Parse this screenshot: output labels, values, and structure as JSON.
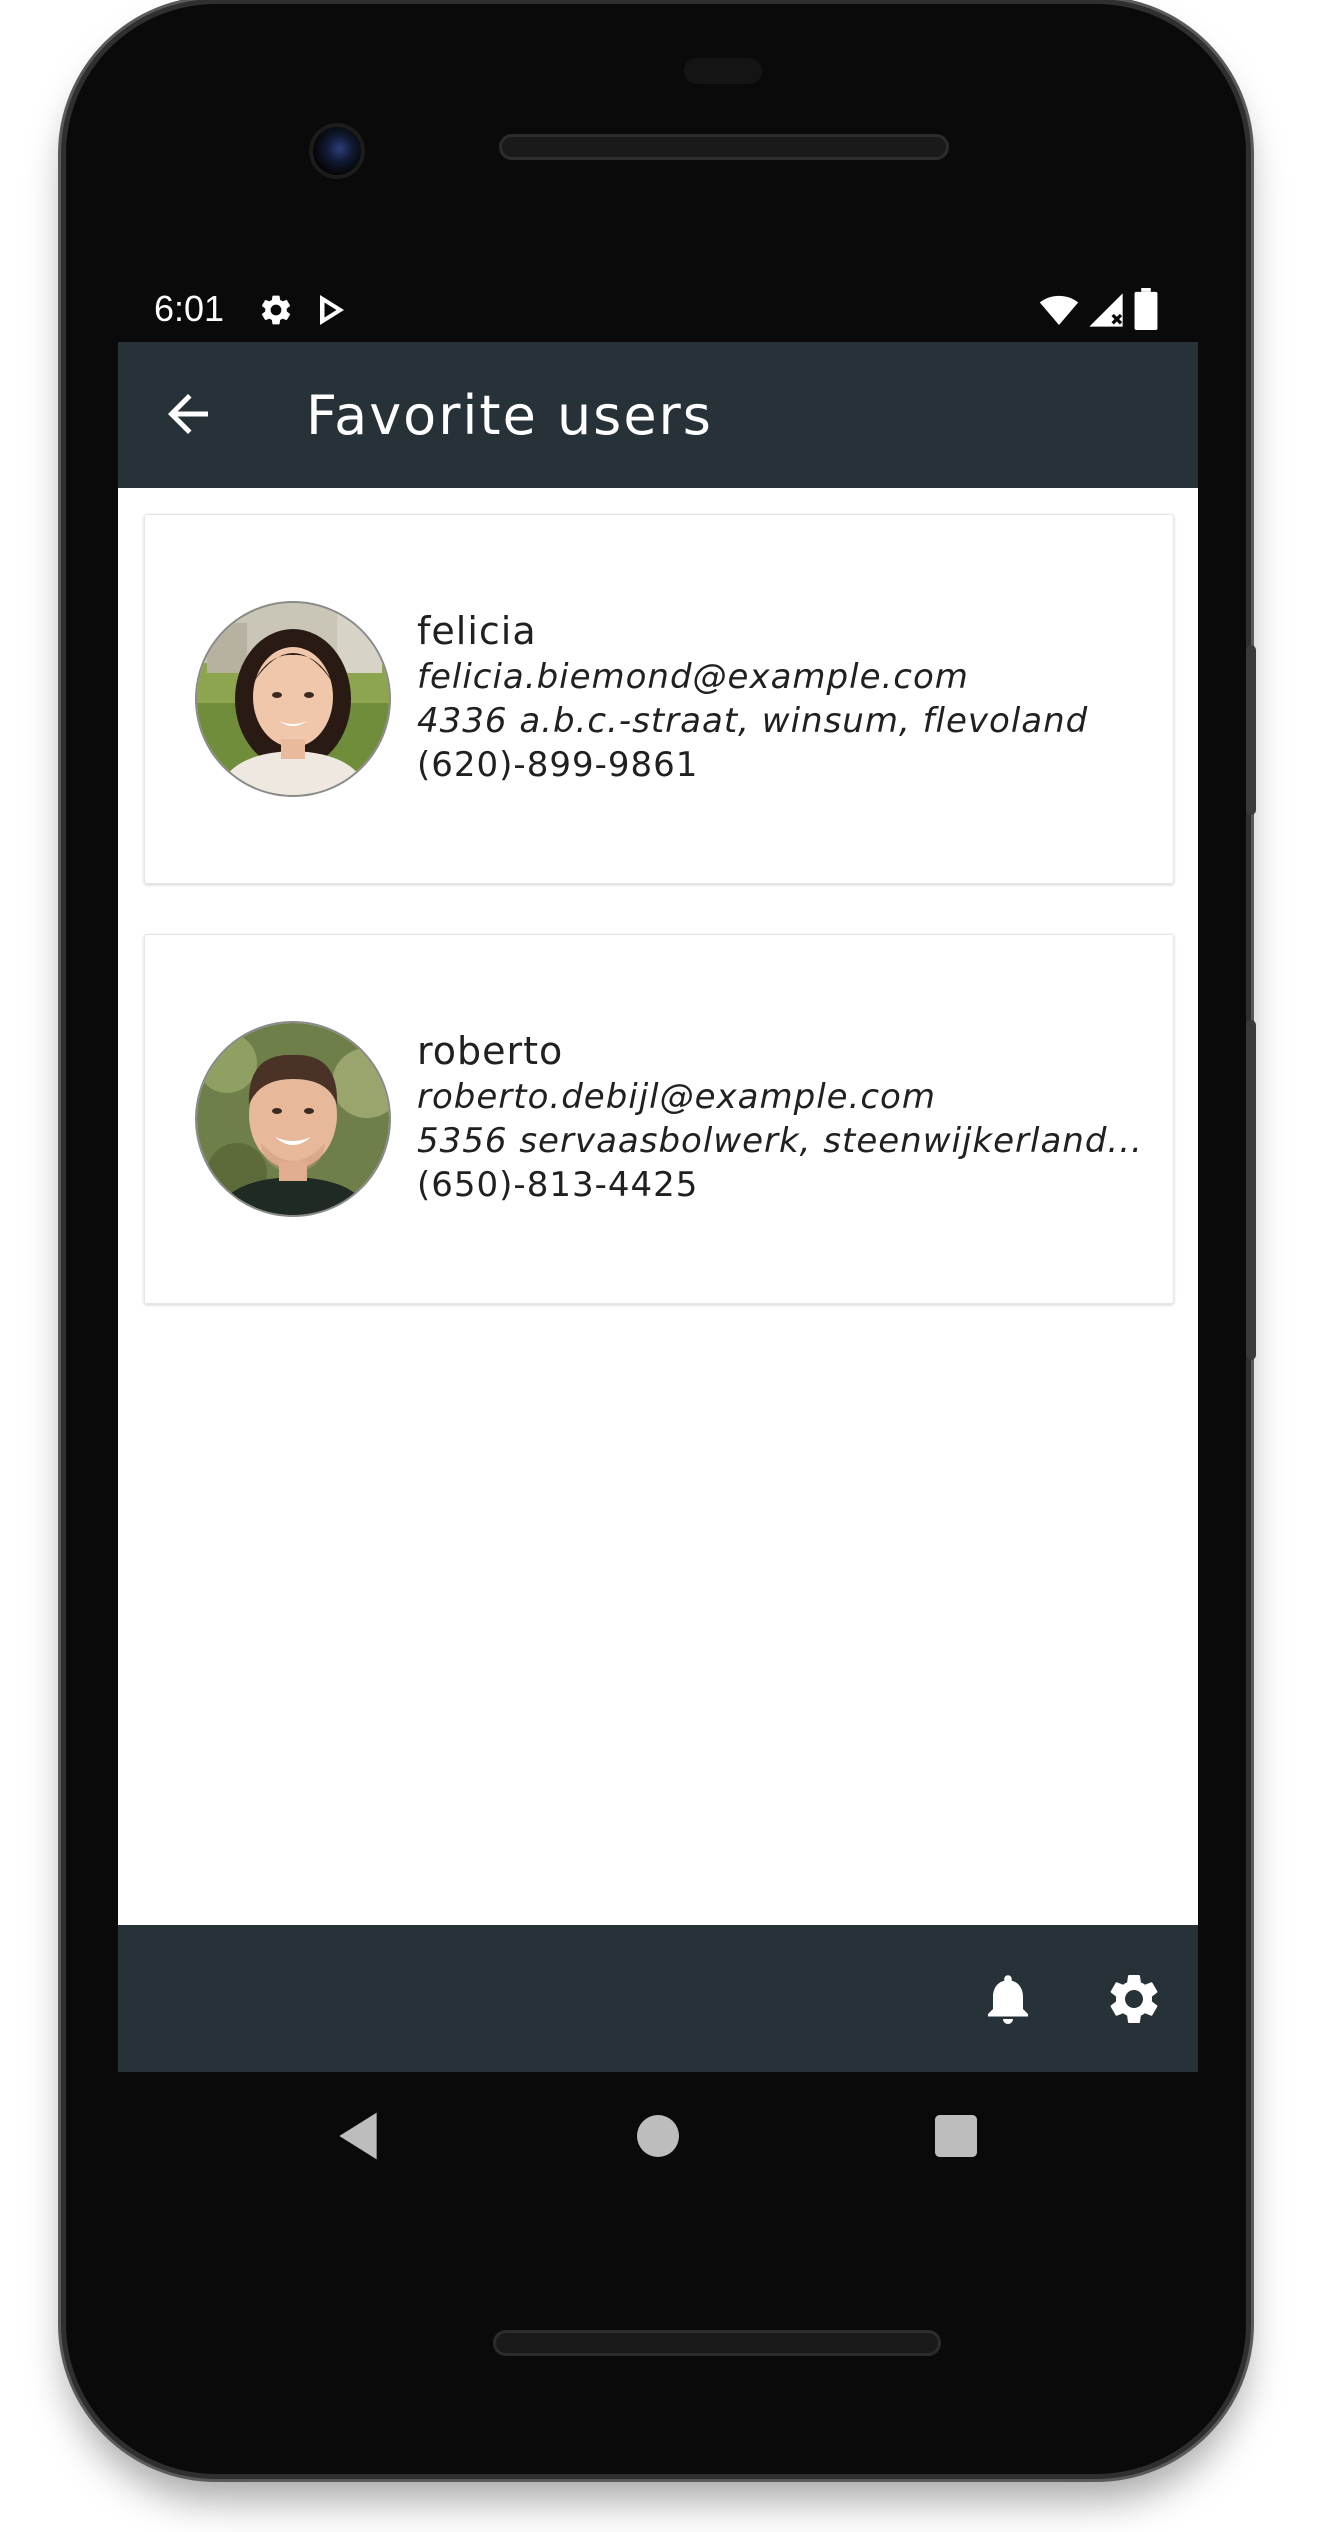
{
  "status_bar": {
    "time": "6:01",
    "icons": [
      "settings-icon",
      "play-store-icon",
      "wifi-icon",
      "signal-icon",
      "battery-icon"
    ]
  },
  "app_bar": {
    "title": "Favorite users",
    "back_icon": "arrow-back-icon"
  },
  "users": [
    {
      "name": "felicia",
      "email": "felicia.biemond@example.com",
      "address": "4336 a.b.c.-straat, winsum, flevoland",
      "phone": "(620)-899-9861"
    },
    {
      "name": "roberto",
      "email": "roberto.debijl@example.com",
      "address": "5356 servaasbolwerk, steenwijkerland...",
      "phone": "(650)-813-4425"
    }
  ],
  "bottom_bar": {
    "icons": [
      "notifications-bell-icon",
      "settings-gear-icon"
    ]
  },
  "nav_bar": {
    "icons": [
      "nav-back-icon",
      "nav-home-icon",
      "nav-recents-icon"
    ]
  },
  "colors": {
    "app_bar": "#263238",
    "screen_background": "#ffffff",
    "text": "#202020"
  }
}
